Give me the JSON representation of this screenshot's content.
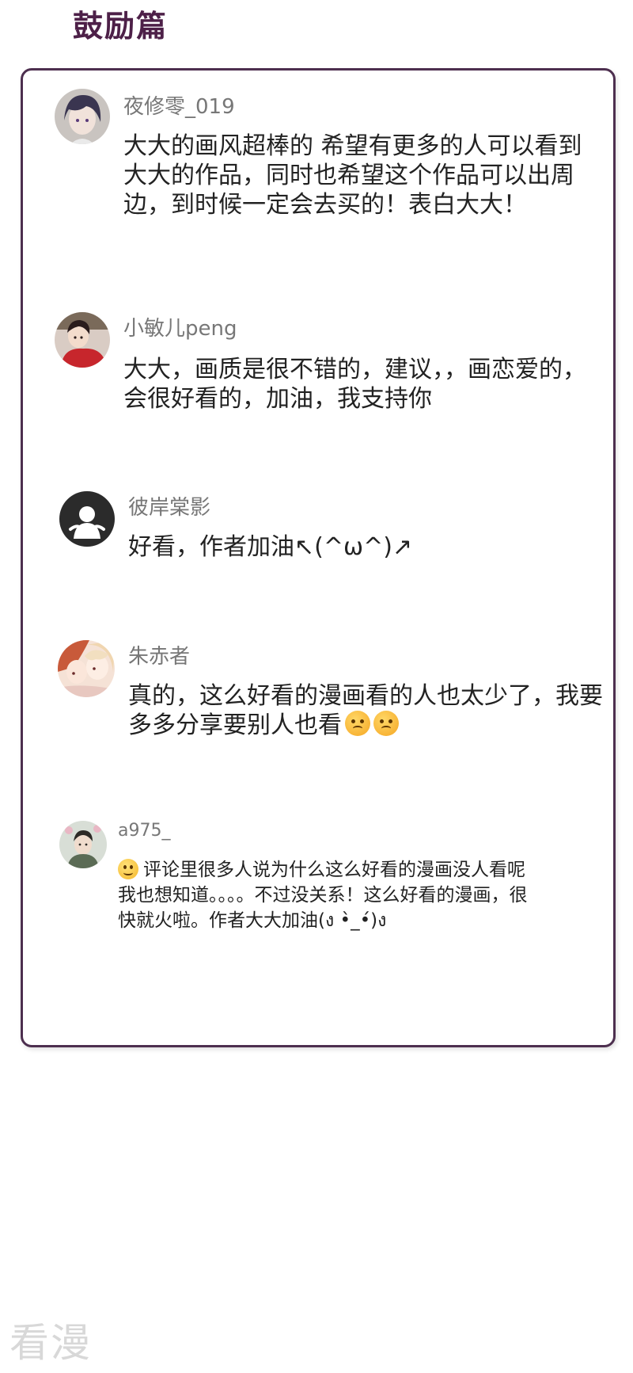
{
  "page": {
    "title": "鼓励篇",
    "watermark": "看漫"
  },
  "comments": [
    {
      "username": "夜修零_019",
      "text": "大大的画风超棒的 希望有更多的人可以看到大大的作品，同时也希望这个作品可以出周边，到时候一定会去买的！表白大大！",
      "avatar_icon": "avatar-dark-haired-boy"
    },
    {
      "username": "小敏儿peng",
      "text": "大大，画质是很不错的，建议，，画恋爱的，会很好看的，加油，我支持你",
      "avatar_icon": "avatar-girl-red-outfit"
    },
    {
      "username": "彼岸棠影",
      "text": "好看，作者加油↖(^ω^)↗",
      "avatar_icon": "avatar-default-silhouette"
    },
    {
      "username": "朱赤者",
      "text": "真的，这么好看的漫画看的人也太少了，我要多多分享要别人也看",
      "avatar_icon": "avatar-anime-couple"
    },
    {
      "username": "a975_",
      "text_line1": "评论里很多人说为什么这么好看的漫画没人看呢",
      "text_line2": "我也想知道。。。。不过没关系！这么好看的漫画，很快就火啦。作者大大加油(ง •̀_•́)ง",
      "avatar_icon": "avatar-boy-flowers"
    }
  ],
  "colors": {
    "title": "#4d2048",
    "border": "#4d2f4f",
    "username": "#777777",
    "text": "#222222"
  }
}
